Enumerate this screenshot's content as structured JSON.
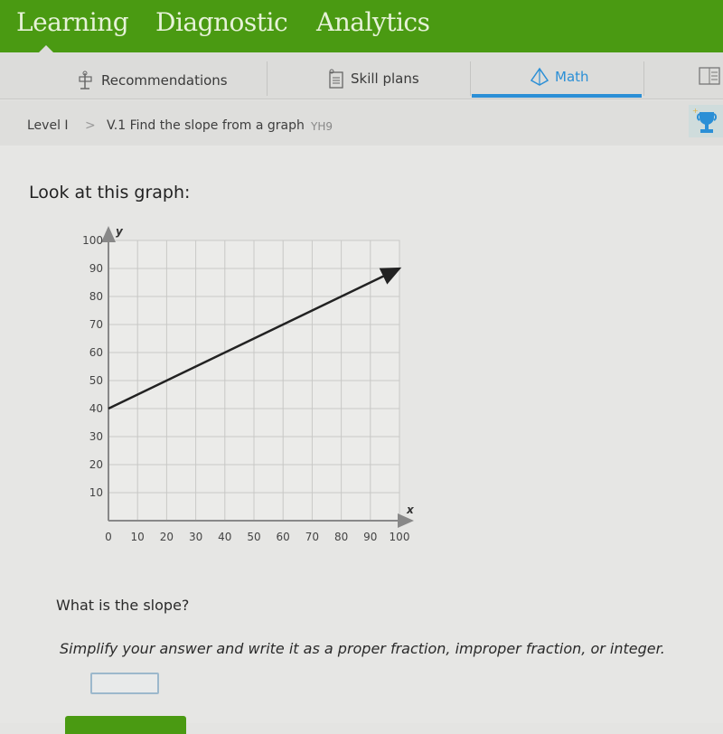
{
  "top_nav": {
    "tabs": [
      {
        "label": "Learning",
        "active": true
      },
      {
        "label": "Diagnostic",
        "active": false
      },
      {
        "label": "Analytics",
        "active": false
      }
    ],
    "brand_color": "#4a9a12"
  },
  "sub_nav": {
    "items": [
      {
        "label": "Recommendations",
        "icon": "signpost-icon",
        "active": false
      },
      {
        "label": "Skill plans",
        "icon": "clipboard-icon",
        "active": false
      },
      {
        "label": "Math",
        "icon": "pyramid-icon",
        "active": true
      },
      {
        "label": "",
        "icon": "book-icon",
        "active": false
      }
    ],
    "active_color": "#2b8fd6"
  },
  "breadcrumb": {
    "level": "Level I",
    "separator": ">",
    "skill": "V.1 Find the slope from a graph",
    "code": "YH9"
  },
  "award_icon": "trophy-icon",
  "problem": {
    "prompt": "Look at this graph:",
    "question": "What is the slope?",
    "instructions": "Simplify your answer and write it as a proper fraction, improper fraction, or integer.",
    "answer_value": ""
  },
  "chart_data": {
    "type": "line",
    "title": "",
    "xlabel": "x",
    "ylabel": "y",
    "xlim": [
      0,
      100
    ],
    "ylim": [
      0,
      100
    ],
    "grid": true,
    "x_ticks": [
      "0",
      "10",
      "20",
      "30",
      "40",
      "50",
      "60",
      "70",
      "80",
      "90",
      "100"
    ],
    "y_ticks": [
      "10",
      "20",
      "30",
      "40",
      "50",
      "60",
      "70",
      "80",
      "90",
      "100"
    ],
    "series": [
      {
        "name": "line",
        "points": [
          [
            0,
            40
          ],
          [
            100,
            90
          ]
        ],
        "arrow_end": true
      }
    ]
  }
}
